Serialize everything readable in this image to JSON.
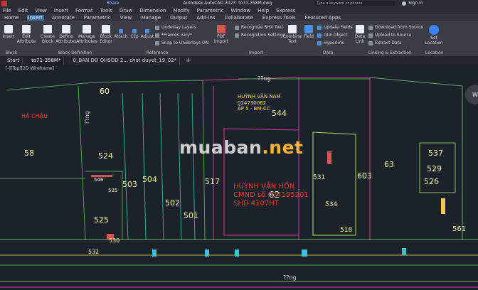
{
  "titlebar": {
    "share": "Share",
    "app_title": "Autodesk AutoCAD 2023",
    "file_name": "to71-358M.dwg",
    "search_placeholder": "Type a keyword or phrase",
    "sign_in": "Sign In"
  },
  "menubar": [
    "File",
    "Edit",
    "View",
    "Insert",
    "Format",
    "Tools",
    "Draw",
    "Dimension",
    "Modify",
    "Parametric",
    "Window",
    "Help",
    "Express"
  ],
  "ribbon_tabs": [
    "Home",
    "Insert",
    "Annotate",
    "Parametric",
    "View",
    "Manage",
    "Output",
    "Add-ins",
    "Collaborate",
    "Express Tools",
    "Featured Apps"
  ],
  "ribbon": {
    "tools": {
      "insert": "Insert",
      "edit_attribute": "Edit\nAttribute",
      "create_block": "Create\nBlock",
      "define_attributes": "Define\nAttributes",
      "manage_attributes": "Manage\nAttributes",
      "block_editor": "Block\nEditor",
      "attach": "Attach",
      "clip": "Clip",
      "adjust": "Adjust",
      "underlay_layers": "Underlay Layers",
      "frames_vary": "*Frames vary*",
      "snap_to_underlays": "Snap to Underlays ON",
      "pdf_import": "PDF\nImport",
      "recognize_shx": "Recognize SHX Text",
      "recognition_settings": "Recognition Settings",
      "combine_text": "Combine\nText",
      "field": "Field",
      "update_fields": "Update Fields",
      "ole_object": "OLE Object",
      "hyperlink": "Hyperlink",
      "data_link": "Data\nLink",
      "download_from_source": "Download from Source",
      "upload_to_source": "Upload to Source",
      "extract_data": "Extract Data",
      "set_location": "Set\nLocation"
    },
    "panels": {
      "block": "Block",
      "block_definition": "Block Definition",
      "reference": "Reference",
      "import": "Import",
      "data": "Data",
      "linking_extraction": "Linking & Extraction",
      "location": "Location"
    }
  },
  "doc_tabs": [
    "Start",
    "to71-358M*",
    "0_BAN DO QHSDD 2... chot duyet_19_02*"
  ],
  "viewport": {
    "label": "[-][Top][2D Wireframe]",
    "parcels": [
      "60",
      "58",
      "524",
      "503",
      "504",
      "502",
      "501",
      "517",
      "544",
      "62",
      "531",
      "534",
      "518",
      "603",
      "63",
      "537",
      "529",
      "526",
      "561",
      "525",
      "532",
      "530",
      "546",
      "535"
    ],
    "owners": [
      {
        "text": "HUỲNH VĂN NAM"
      },
      {
        "text": "024730062"
      },
      {
        "text": "ẤP 5 - BM-CC"
      },
      {
        "text": "HUỲNH VĂN HỒN"
      },
      {
        "text": "CMND số 024195201"
      },
      {
        "text": "SHD 4107HT"
      },
      {
        "text": "HÀ CHÂU"
      }
    ],
    "road_labels": [
      "??ng",
      "??ng",
      "??ng"
    ],
    "watermark": {
      "main": "muaban",
      "suffix": ".net"
    }
  }
}
